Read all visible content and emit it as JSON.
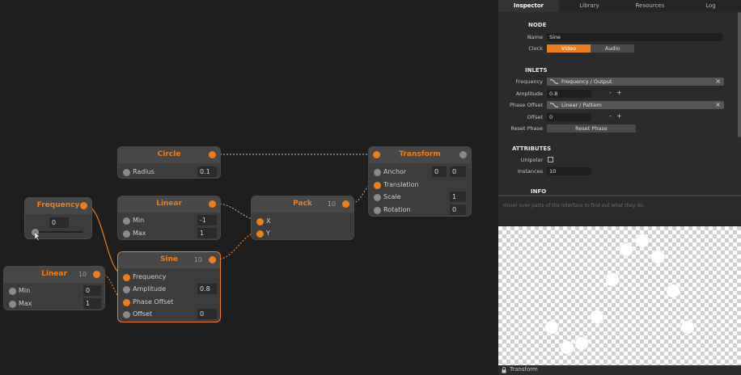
{
  "nodes": {
    "circle": {
      "title": "Circle",
      "inlets": [
        {
          "label": "Radius",
          "value": "0.1"
        }
      ]
    },
    "transform": {
      "title": "Transform",
      "inlets": [
        {
          "label": "Anchor",
          "value": "0",
          "value2": "0"
        },
        {
          "label": "Translation"
        },
        {
          "label": "Scale",
          "value": "1"
        },
        {
          "label": "Rotation",
          "value": "0"
        }
      ]
    },
    "frequency": {
      "title": "Frequency",
      "value": "0"
    },
    "linear_top": {
      "title": "Linear",
      "inlets": [
        {
          "label": "Min",
          "value": "-1"
        },
        {
          "label": "Max",
          "value": "1"
        }
      ]
    },
    "pack": {
      "title": "Pack",
      "count": "10",
      "inlets": [
        {
          "label": "X"
        },
        {
          "label": "Y"
        }
      ]
    },
    "sine": {
      "title": "Sine",
      "count": "10",
      "inlets": [
        {
          "label": "Frequency"
        },
        {
          "label": "Amplitude",
          "value": "0.8"
        },
        {
          "label": "Phase Offset"
        },
        {
          "label": "Offset",
          "value": "0"
        }
      ]
    },
    "linear_left": {
      "title": "Linear",
      "count": "10",
      "inlets": [
        {
          "label": "Min",
          "value": "0"
        },
        {
          "label": "Max",
          "value": "1"
        }
      ]
    }
  },
  "inspector": {
    "tabs": [
      "Inspector",
      "Library",
      "Resources",
      "Log"
    ],
    "node_section": "NODE",
    "name_label": "Name",
    "name_value": "Sine",
    "clock_label": "Clock",
    "clock_options": [
      "Video",
      "Audio"
    ],
    "clock_selected": "Video",
    "inlets_section": "INLETS",
    "inlets": {
      "frequency_label": "Frequency",
      "frequency_link": "Frequency / Output",
      "amplitude_label": "Amplitude",
      "amplitude_value": "0.8",
      "phase_offset_label": "Phase Offset",
      "phase_offset_link": "Linear / Pattern",
      "offset_label": "Offset",
      "offset_value": "0",
      "reset_phase_label": "Reset Phase",
      "reset_phase_button": "Reset Phase"
    },
    "attributes_section": "ATTRIBUTES",
    "unipolar_label": "Unipolar",
    "unipolar_checked": false,
    "instances_label": "Instances",
    "instances_value": "10",
    "info_section": "INFO",
    "minus": "-",
    "plus": "+",
    "close_symbol": "×"
  },
  "hint_text": "Hover over parts of the interface to find out what they do.",
  "status": {
    "node_label": "Transform"
  },
  "colors": {
    "accent": "#ef7d1a",
    "node_bg": "#3c3c3c",
    "canvas_bg": "#1e1e1e",
    "panel_bg": "#2b2b2b"
  },
  "icons": {
    "link": "link-icon",
    "lock": "lock-icon",
    "close": "close-icon"
  }
}
